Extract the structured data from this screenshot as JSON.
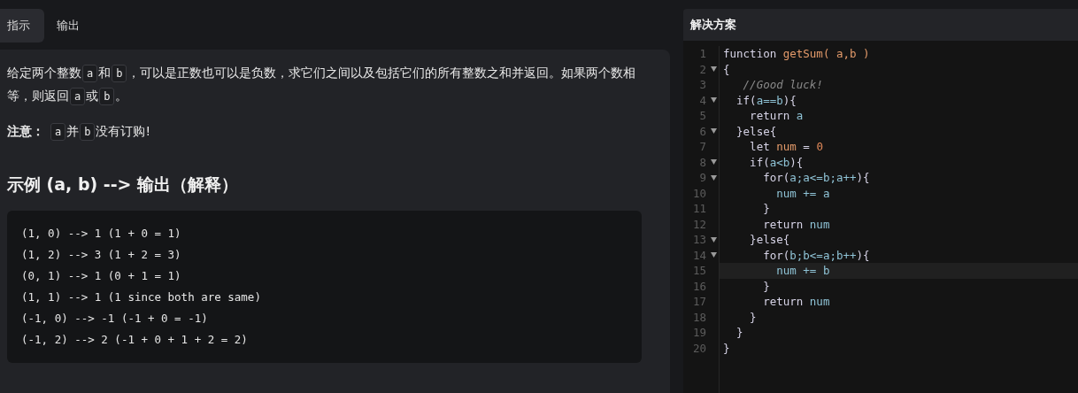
{
  "tabs": [
    {
      "label": "指示",
      "selected": true
    },
    {
      "label": "输出",
      "selected": false
    }
  ],
  "description": {
    "paragraphs": [
      {
        "segments": [
          {
            "kind": "text",
            "text": "给定两个整数"
          },
          {
            "kind": "code",
            "text": "a"
          },
          {
            "kind": "text",
            "text": "和"
          },
          {
            "kind": "code",
            "text": "b"
          },
          {
            "kind": "text",
            "text": "，可以是正数也可以是负数，求它们之间以及包括它们的所有整数之和并返回。如果两个数相等，则返回"
          },
          {
            "kind": "code",
            "text": "a"
          },
          {
            "kind": "text",
            "text": "或"
          },
          {
            "kind": "code",
            "text": "b"
          },
          {
            "kind": "text",
            "text": "。"
          }
        ]
      },
      {
        "segments": [
          {
            "kind": "strong",
            "text": "注意："
          },
          {
            "kind": "code",
            "text": "a"
          },
          {
            "kind": "text",
            "text": "并"
          },
          {
            "kind": "code",
            "text": "b"
          },
          {
            "kind": "text",
            "text": "没有订购!"
          }
        ]
      }
    ],
    "heading": "示例 (a, b) --> 输出（解释）",
    "examples": [
      "(1, 0) --> 1 (1 + 0 = 1)",
      "(1, 2) --> 3 (1 + 2 = 3)",
      "(0, 1) --> 1 (0 + 1 = 1)",
      "(1, 1) --> 1 (1 since both are same)",
      "(-1, 0) --> -1 (-1 + 0 = -1)",
      "(-1, 2) --> 2 (-1 + 0 + 1 + 2 = 2)"
    ]
  },
  "solution": {
    "title": "解决方案",
    "lines": [
      {
        "number": "1",
        "foldable": false,
        "highlighted": false,
        "tokens": [
          {
            "kind": "kw",
            "text": "function "
          },
          {
            "kind": "fn",
            "text": "getSum( a,b )"
          }
        ]
      },
      {
        "number": "2",
        "foldable": true,
        "highlighted": false,
        "tokens": [
          {
            "kind": "kw",
            "text": "{"
          }
        ]
      },
      {
        "number": "3",
        "foldable": false,
        "highlighted": false,
        "tokens": [
          {
            "kind": "comment",
            "text": "   //Good luck!"
          }
        ]
      },
      {
        "number": "4",
        "foldable": true,
        "highlighted": false,
        "tokens": [
          {
            "kind": "kw",
            "text": "  if("
          },
          {
            "kind": "var",
            "text": "a==b"
          },
          {
            "kind": "kw",
            "text": "){"
          }
        ]
      },
      {
        "number": "5",
        "foldable": false,
        "highlighted": false,
        "tokens": [
          {
            "kind": "kw",
            "text": "    return "
          },
          {
            "kind": "var",
            "text": "a"
          }
        ]
      },
      {
        "number": "6",
        "foldable": true,
        "highlighted": false,
        "tokens": [
          {
            "kind": "kw",
            "text": "  }else{"
          }
        ]
      },
      {
        "number": "7",
        "foldable": false,
        "highlighted": false,
        "tokens": [
          {
            "kind": "kw",
            "text": "    let "
          },
          {
            "kind": "fn",
            "text": "num"
          },
          {
            "kind": "kw",
            "text": " = "
          },
          {
            "kind": "num",
            "text": "0"
          }
        ]
      },
      {
        "number": "8",
        "foldable": true,
        "highlighted": false,
        "tokens": [
          {
            "kind": "kw",
            "text": "    if("
          },
          {
            "kind": "var",
            "text": "a<b"
          },
          {
            "kind": "kw",
            "text": "){"
          }
        ]
      },
      {
        "number": "9",
        "foldable": true,
        "highlighted": false,
        "tokens": [
          {
            "kind": "kw",
            "text": "      for("
          },
          {
            "kind": "var",
            "text": "a;a<=b;a++"
          },
          {
            "kind": "kw",
            "text": "){"
          }
        ]
      },
      {
        "number": "10",
        "foldable": false,
        "highlighted": false,
        "tokens": [
          {
            "kind": "var",
            "text": "        num += a"
          }
        ]
      },
      {
        "number": "11",
        "foldable": false,
        "highlighted": false,
        "tokens": [
          {
            "kind": "kw",
            "text": "      }"
          }
        ]
      },
      {
        "number": "12",
        "foldable": false,
        "highlighted": false,
        "tokens": [
          {
            "kind": "kw",
            "text": "      return "
          },
          {
            "kind": "var",
            "text": "num"
          }
        ]
      },
      {
        "number": "13",
        "foldable": true,
        "highlighted": false,
        "tokens": [
          {
            "kind": "kw",
            "text": "    }else{"
          }
        ]
      },
      {
        "number": "14",
        "foldable": true,
        "highlighted": false,
        "tokens": [
          {
            "kind": "kw",
            "text": "      for("
          },
          {
            "kind": "var",
            "text": "b;b<=a;b++"
          },
          {
            "kind": "kw",
            "text": "){"
          }
        ]
      },
      {
        "number": "15",
        "foldable": false,
        "highlighted": true,
        "tokens": [
          {
            "kind": "var",
            "text": "        num += b"
          }
        ]
      },
      {
        "number": "16",
        "foldable": false,
        "highlighted": false,
        "tokens": [
          {
            "kind": "kw",
            "text": "      }"
          }
        ]
      },
      {
        "number": "17",
        "foldable": false,
        "highlighted": false,
        "tokens": [
          {
            "kind": "kw",
            "text": "      return "
          },
          {
            "kind": "var",
            "text": "num"
          }
        ]
      },
      {
        "number": "18",
        "foldable": false,
        "highlighted": false,
        "tokens": [
          {
            "kind": "kw",
            "text": "    }"
          }
        ]
      },
      {
        "number": "19",
        "foldable": false,
        "highlighted": false,
        "tokens": [
          {
            "kind": "kw",
            "text": "  }"
          }
        ]
      },
      {
        "number": "20",
        "foldable": false,
        "highlighted": false,
        "tokens": [
          {
            "kind": "kw",
            "text": "}"
          }
        ]
      }
    ]
  }
}
